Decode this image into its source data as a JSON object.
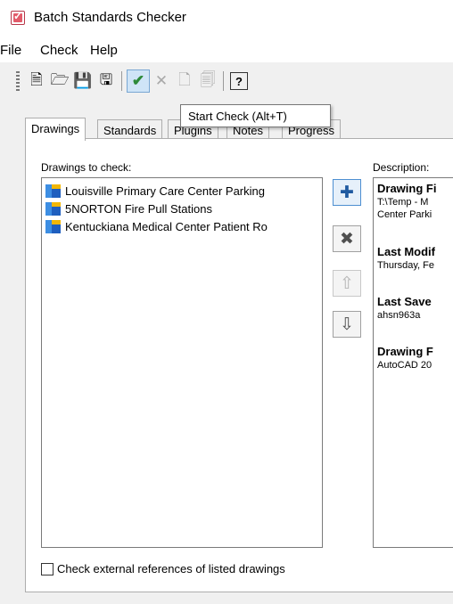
{
  "window": {
    "title": "Batch Standards Checker"
  },
  "menu": [
    "File",
    "Check",
    "Help"
  ],
  "toolbar": {
    "icons": [
      "new-icon",
      "open-icon",
      "save-icon",
      "save-as-icon",
      "start-check-icon",
      "stop-check-icon",
      "export-icon",
      "report-icon",
      "help-icon"
    ],
    "tooltip": "Start Check (Alt+T)"
  },
  "tabs": [
    "Drawings",
    "Standards",
    "Plugins",
    "Notes",
    "Progress"
  ],
  "drawings": {
    "label": "Drawings to check:",
    "items": [
      "Louisville Primary Care Center Parking",
      "5NORTON Fire Pull Stations",
      "Kentuckiana Medical Center Patient Ro"
    ]
  },
  "description": {
    "label": "Description:",
    "drawing_file_heading": "Drawing Fi",
    "drawing_file_line1": "T:\\Temp - M",
    "drawing_file_line2": "Center Parki",
    "last_modified_heading": "Last Modif",
    "last_modified_value": "Thursday, Fe",
    "last_saved_heading": "Last Save",
    "last_saved_value": "ahsn963a",
    "drawing_format_heading": "Drawing F",
    "drawing_format_value": "AutoCAD 20"
  },
  "xref_checkbox": {
    "label": "Check external references of listed drawings",
    "checked": false
  }
}
